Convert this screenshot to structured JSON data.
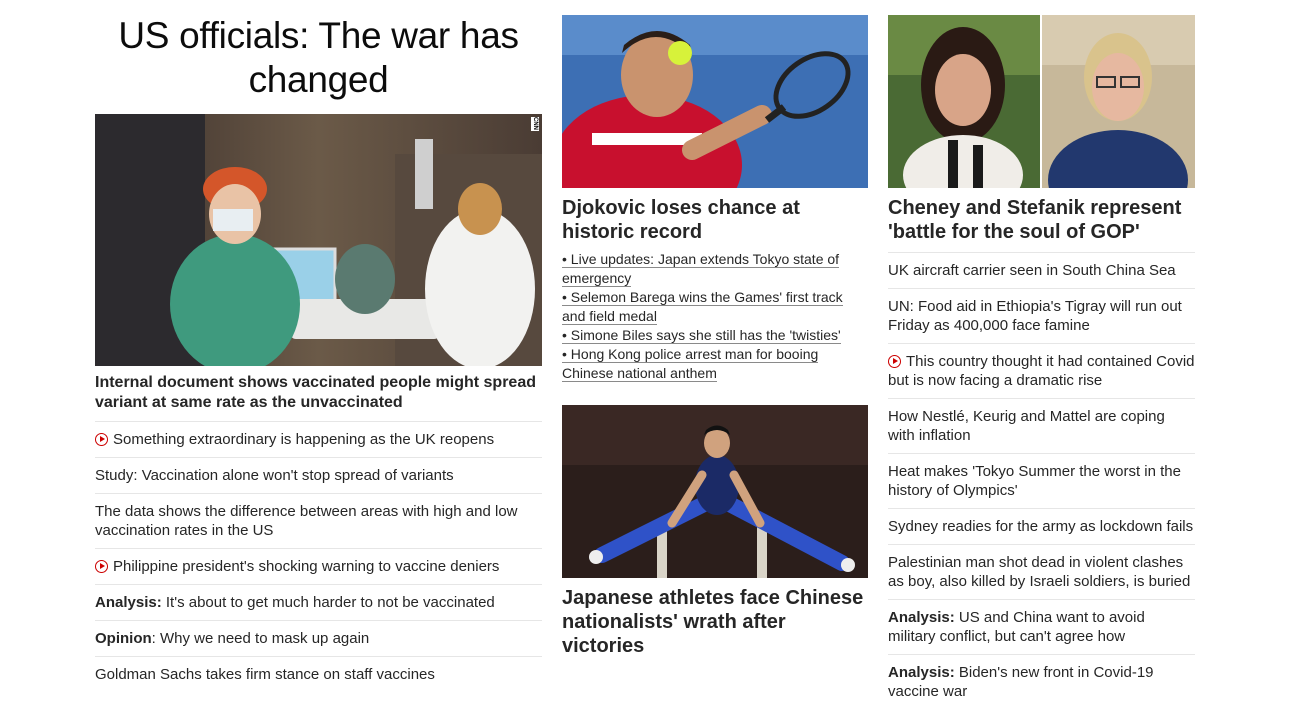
{
  "column1": {
    "headline": "US officials: The war has changed",
    "image_watermark": "CNN",
    "lead_link": "Internal document shows vaccinated people might spread variant at same rate as the unvaccinated",
    "links": [
      {
        "prefix": "",
        "text": "Something extraordinary is happening as the UK reopens",
        "video": true
      },
      {
        "prefix": "",
        "text": "Study: Vaccination alone won't stop spread of variants",
        "video": false
      },
      {
        "prefix": "",
        "text": "The data shows the difference between areas with high and low vaccination rates in the US",
        "video": false
      },
      {
        "prefix": "",
        "text": "Philippine president's shocking warning to vaccine deniers",
        "video": true
      },
      {
        "prefix": "Analysis:",
        "text": " It's about to get much harder to not be vaccinated",
        "video": false
      },
      {
        "prefix": "Opinion",
        "text": ": Why we need to mask up again",
        "video": false
      },
      {
        "prefix": "",
        "text": "Goldman Sachs takes firm stance on staff vaccines",
        "video": false
      }
    ]
  },
  "column2": {
    "card1": {
      "title": "Djokovic loses chance at historic record",
      "bullets": [
        "• Live updates: Japan extends Tokyo state of emergency",
        "• Selemon Barega wins the Games' first track and field medal",
        "• Simone Biles says she still has the 'twisties'",
        "• Hong Kong police arrest man for booing Chinese national anthem"
      ]
    },
    "card2": {
      "title": "Japanese athletes face Chinese nationalists' wrath after victories"
    }
  },
  "column3": {
    "title": "Cheney and Stefanik represent 'battle for the soul of GOP'",
    "links": [
      {
        "prefix": "",
        "text": "UK aircraft carrier seen in South China Sea",
        "video": false
      },
      {
        "prefix": "",
        "text": "UN: Food aid in Ethiopia's Tigray will run out Friday as 400,000 face famine",
        "video": false
      },
      {
        "prefix": "",
        "text": "This country thought it had contained Covid but is now facing a dramatic rise",
        "video": true
      },
      {
        "prefix": "",
        "text": "How Nestlé, Keurig and Mattel are coping with inflation",
        "video": false
      },
      {
        "prefix": "",
        "text": "Heat makes 'Tokyo Summer the worst in the history of Olympics'",
        "video": false
      },
      {
        "prefix": "",
        "text": "Sydney readies for the army as lockdown fails",
        "video": false
      },
      {
        "prefix": "",
        "text": "Palestinian man shot dead in violent clashes as boy, also killed by Israeli soldiers, is buried",
        "video": false
      },
      {
        "prefix": "Analysis:",
        "text": " US and China want to avoid military conflict, but can't agree how",
        "video": false
      },
      {
        "prefix": "Analysis:",
        "text": " Biden's new front in Covid-19 vaccine war",
        "video": false
      }
    ]
  },
  "colors": {
    "text": "#262626",
    "video_icon": "#cc0000",
    "divider": "#e6e6e6"
  }
}
